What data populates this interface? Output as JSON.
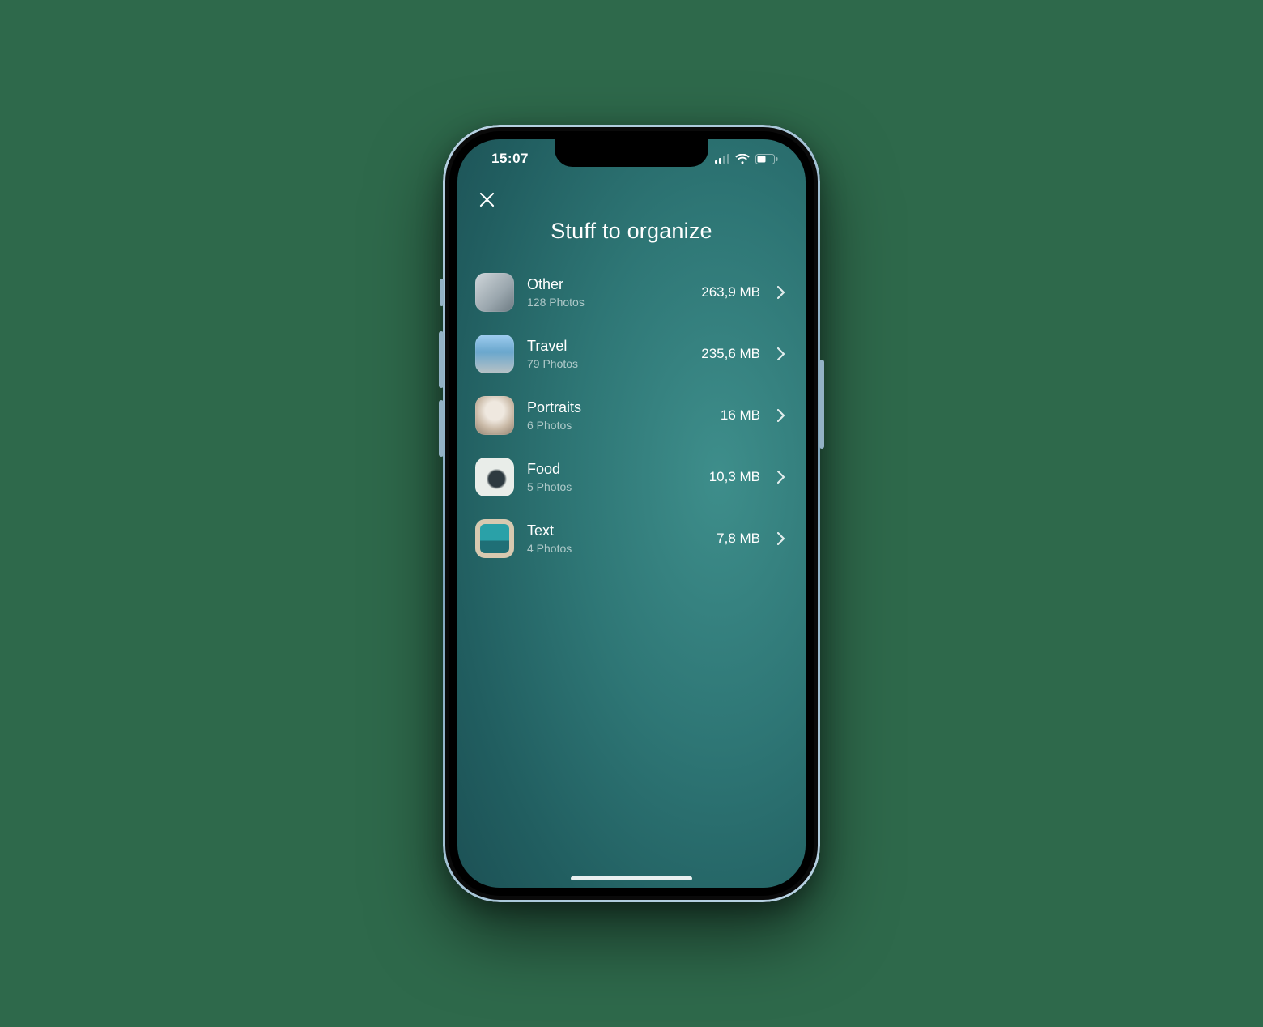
{
  "statusbar": {
    "time": "15:07"
  },
  "header": {
    "title": "Stuff to organize"
  },
  "categories": [
    {
      "name": "Other",
      "subtitle": "128 Photos",
      "size": "263,9 MB",
      "thumb": "other"
    },
    {
      "name": "Travel",
      "subtitle": "79 Photos",
      "size": "235,6 MB",
      "thumb": "travel"
    },
    {
      "name": "Portraits",
      "subtitle": "6 Photos",
      "size": "16 MB",
      "thumb": "portraits"
    },
    {
      "name": "Food",
      "subtitle": "5 Photos",
      "size": "10,3 MB",
      "thumb": "food"
    },
    {
      "name": "Text",
      "subtitle": "4 Photos",
      "size": "7,8 MB",
      "thumb": "text"
    }
  ]
}
